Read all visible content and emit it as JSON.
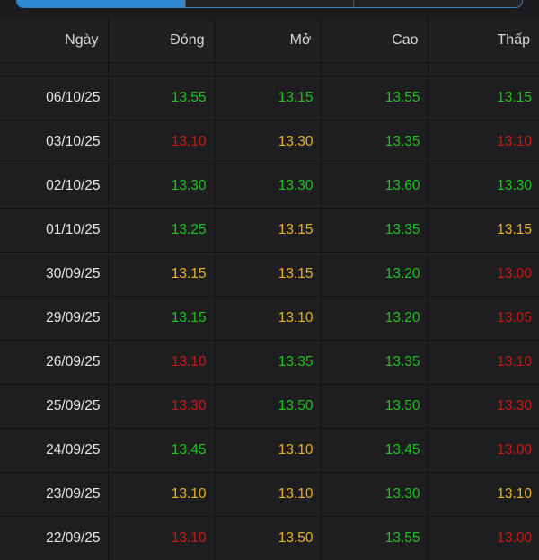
{
  "header": {
    "columns": [
      "Ngày",
      "Đóng",
      "Mở",
      "Cao",
      "Thấp"
    ]
  },
  "colors": {
    "up": "#1bc41b",
    "reference": "#e5b21e",
    "down": "#c81818",
    "tab_active": "#2f8ad6"
  },
  "rows": [
    {
      "date": "06/10/25",
      "close": "13.55",
      "close_c": "up",
      "open": "13.15",
      "open_c": "up",
      "high": "13.55",
      "high_c": "up",
      "low": "13.15",
      "low_c": "up"
    },
    {
      "date": "03/10/25",
      "close": "13.10",
      "close_c": "down",
      "open": "13.30",
      "open_c": "ref",
      "high": "13.35",
      "high_c": "up",
      "low": "13.10",
      "low_c": "down"
    },
    {
      "date": "02/10/25",
      "close": "13.30",
      "close_c": "up",
      "open": "13.30",
      "open_c": "up",
      "high": "13.60",
      "high_c": "up",
      "low": "13.30",
      "low_c": "up"
    },
    {
      "date": "01/10/25",
      "close": "13.25",
      "close_c": "up",
      "open": "13.15",
      "open_c": "ref",
      "high": "13.35",
      "high_c": "up",
      "low": "13.15",
      "low_c": "ref"
    },
    {
      "date": "30/09/25",
      "close": "13.15",
      "close_c": "ref",
      "open": "13.15",
      "open_c": "ref",
      "high": "13.20",
      "high_c": "up",
      "low": "13.00",
      "low_c": "down"
    },
    {
      "date": "29/09/25",
      "close": "13.15",
      "close_c": "up",
      "open": "13.10",
      "open_c": "ref",
      "high": "13.20",
      "high_c": "up",
      "low": "13.05",
      "low_c": "down"
    },
    {
      "date": "26/09/25",
      "close": "13.10",
      "close_c": "down",
      "open": "13.35",
      "open_c": "up",
      "high": "13.35",
      "high_c": "up",
      "low": "13.10",
      "low_c": "down"
    },
    {
      "date": "25/09/25",
      "close": "13.30",
      "close_c": "down",
      "open": "13.50",
      "open_c": "up",
      "high": "13.50",
      "high_c": "up",
      "low": "13.30",
      "low_c": "down"
    },
    {
      "date": "24/09/25",
      "close": "13.45",
      "close_c": "up",
      "open": "13.10",
      "open_c": "ref",
      "high": "13.45",
      "high_c": "up",
      "low": "13.00",
      "low_c": "down"
    },
    {
      "date": "23/09/25",
      "close": "13.10",
      "close_c": "ref",
      "open": "13.10",
      "open_c": "ref",
      "high": "13.30",
      "high_c": "up",
      "low": "13.10",
      "low_c": "ref"
    },
    {
      "date": "22/09/25",
      "close": "13.10",
      "close_c": "down",
      "open": "13.50",
      "open_c": "ref",
      "high": "13.55",
      "high_c": "up",
      "low": "13.00",
      "low_c": "down"
    }
  ]
}
